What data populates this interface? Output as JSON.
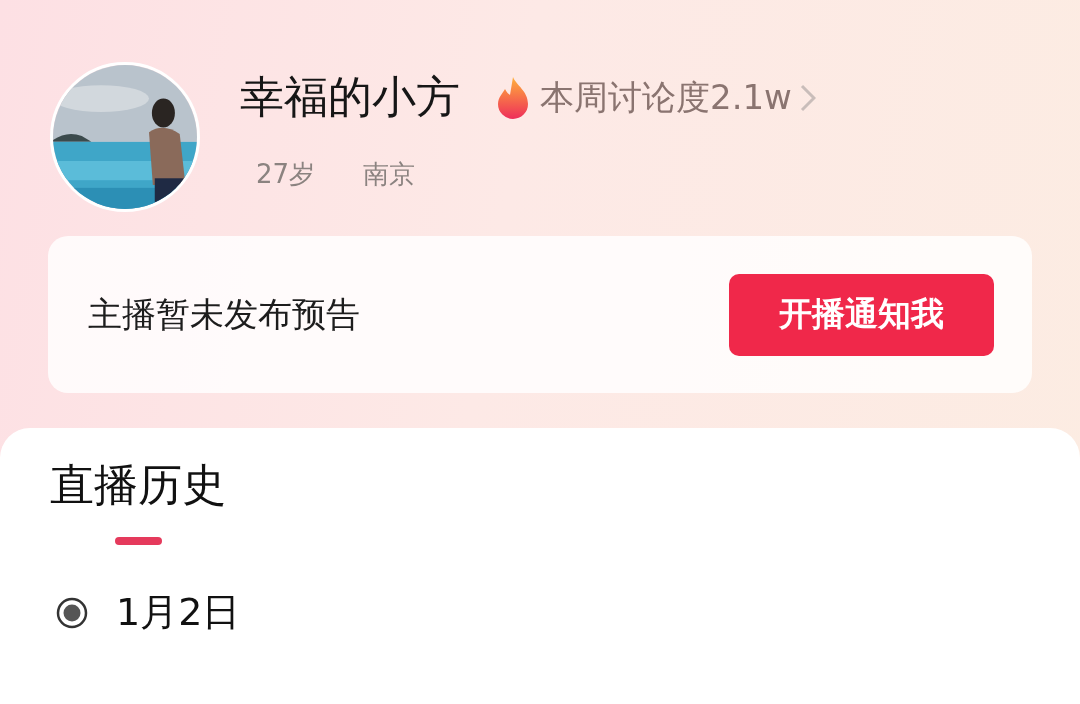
{
  "profile": {
    "name": "幸福的小方",
    "heat": "本周讨论度2.1w",
    "tags": [
      "27岁",
      "南京"
    ]
  },
  "notice": {
    "text": "主播暂未发布预告",
    "button": "开播通知我"
  },
  "history": {
    "tabs": [
      {
        "label": "直播历史",
        "selected": true
      }
    ],
    "entries": [
      {
        "date": "1月2日"
      }
    ]
  }
}
